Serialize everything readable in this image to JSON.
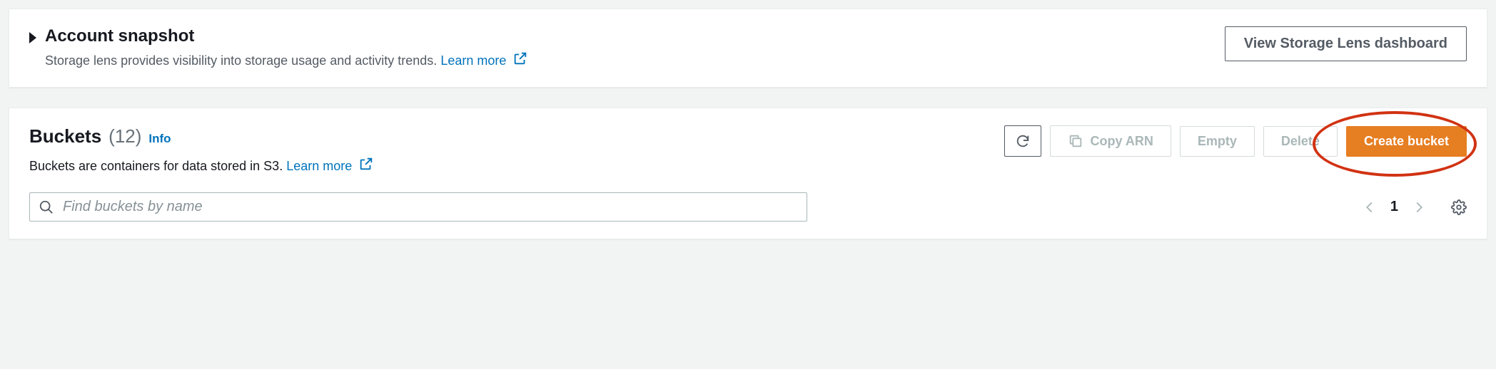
{
  "snapshot": {
    "title": "Account snapshot",
    "description": "Storage lens provides visibility into storage usage and activity trends.",
    "learn_more": "Learn more",
    "view_dashboard": "View Storage Lens dashboard"
  },
  "buckets": {
    "title": "Buckets",
    "count": "(12)",
    "info": "Info",
    "description": "Buckets are containers for data stored in S3.",
    "learn_more": "Learn more",
    "buttons": {
      "copy_arn": "Copy ARN",
      "empty": "Empty",
      "delete": "Delete",
      "create": "Create bucket"
    },
    "search_placeholder": "Find buckets by name",
    "page": "1"
  }
}
